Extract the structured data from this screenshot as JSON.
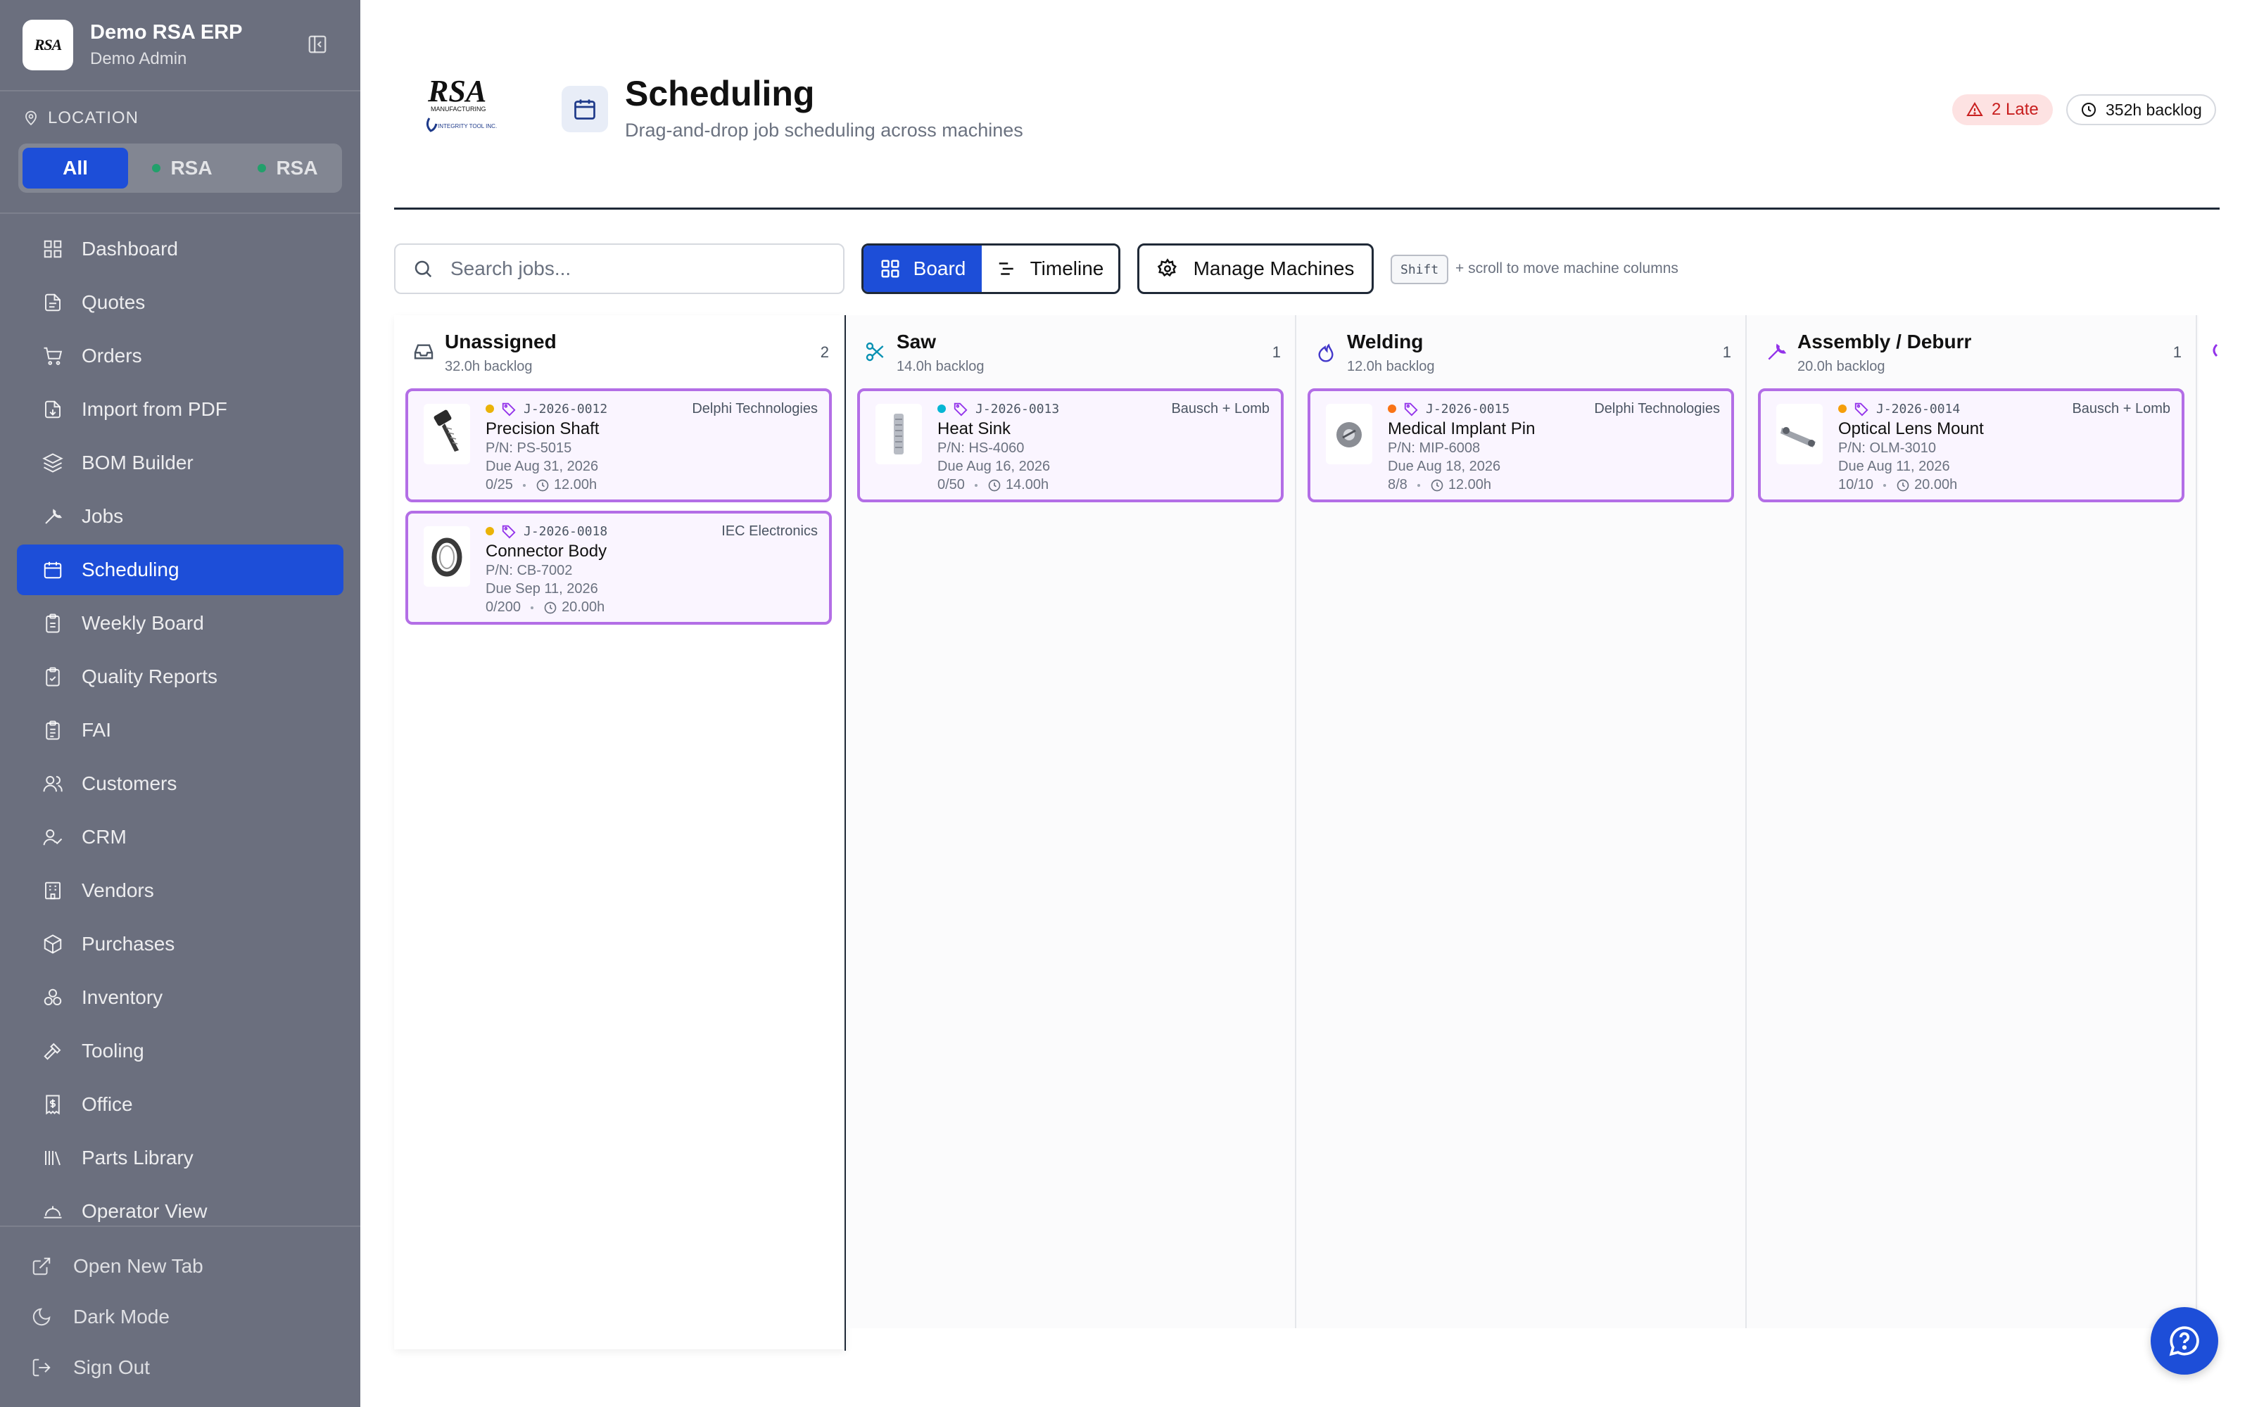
{
  "app": {
    "name": "Demo RSA ERP",
    "user": "Demo Admin",
    "logo_text": "RSA"
  },
  "location": {
    "label": "LOCATION",
    "options": [
      {
        "label": "All",
        "active": true
      },
      {
        "label": "RSA",
        "dot_color": "#22a06b"
      },
      {
        "label": "RSA",
        "dot_color": "#22a06b"
      }
    ]
  },
  "nav": [
    {
      "label": "Dashboard",
      "icon": "dashboard-icon"
    },
    {
      "label": "Quotes",
      "icon": "document-icon"
    },
    {
      "label": "Orders",
      "icon": "cart-icon"
    },
    {
      "label": "Import from PDF",
      "icon": "file-import-icon"
    },
    {
      "label": "BOM Builder",
      "icon": "layers-icon"
    },
    {
      "label": "Jobs",
      "icon": "wrench-icon"
    },
    {
      "label": "Scheduling",
      "icon": "calendar-icon",
      "active": true
    },
    {
      "label": "Weekly Board",
      "icon": "clipboard-icon"
    },
    {
      "label": "Quality Reports",
      "icon": "clipboard-check-icon"
    },
    {
      "label": "FAI",
      "icon": "clipboard-list-icon"
    },
    {
      "label": "Customers",
      "icon": "users-icon"
    },
    {
      "label": "CRM",
      "icon": "user-check-icon"
    },
    {
      "label": "Vendors",
      "icon": "building-icon"
    },
    {
      "label": "Purchases",
      "icon": "package-icon"
    },
    {
      "label": "Inventory",
      "icon": "boxes-icon"
    },
    {
      "label": "Tooling",
      "icon": "hammer-icon"
    },
    {
      "label": "Office",
      "icon": "receipt-icon"
    },
    {
      "label": "Parts Library",
      "icon": "library-icon"
    },
    {
      "label": "Operator View",
      "icon": "operator-icon"
    }
  ],
  "footer": [
    {
      "label": "Open New Tab",
      "icon": "external-link-icon"
    },
    {
      "label": "Dark Mode",
      "icon": "moon-icon"
    },
    {
      "label": "Sign Out",
      "icon": "sign-out-icon"
    }
  ],
  "header": {
    "title": "Scheduling",
    "subtitle": "Drag-and-drop job scheduling across machines",
    "late_badge": "2 Late",
    "backlog_badge": "352h backlog",
    "brand_logo_text": "RSA",
    "brand_logo_sub1": "MANUFACTURING",
    "brand_logo_sub2": "INTEGRITY TOOL INC."
  },
  "toolbar": {
    "search_placeholder": "Search jobs...",
    "view_board": "Board",
    "view_timeline": "Timeline",
    "manage_machines": "Manage Machines",
    "kbd": "Shift",
    "hint": "+ scroll to move machine columns"
  },
  "colors": {
    "accent": "#1d4ed8",
    "card_border": "#b36ee6",
    "card_bg": "#faf5ff",
    "dot_yellow": "#eab308",
    "dot_cyan": "#06b6d4",
    "dot_red": "#f97316",
    "dot_orange": "#f59e0b"
  },
  "columns": [
    {
      "title": "Unassigned",
      "backlog": "32.0h backlog",
      "count": "2",
      "icon": "inbox-icon",
      "jobs": [
        {
          "id": "J-2026-0012",
          "customer": "Delphi Technologies",
          "part": "Precision Shaft",
          "pn": "P/N: PS-5015",
          "due": "Due Aug 31, 2026",
          "qty": "0/25",
          "hours": "12.00h",
          "dot": "#eab308",
          "thumb": "screw-part-icon"
        },
        {
          "id": "J-2026-0018",
          "customer": "IEC Electronics",
          "part": "Connector Body",
          "pn": "P/N: CB-7002",
          "due": "Due Sep 11, 2026",
          "qty": "0/200",
          "hours": "20.00h",
          "dot": "#eab308",
          "thumb": "ring-part-icon"
        }
      ]
    },
    {
      "title": "Saw",
      "backlog": "14.0h backlog",
      "count": "1",
      "icon": "scissors-icon",
      "jobs": [
        {
          "id": "J-2026-0013",
          "customer": "Bausch + Lomb",
          "part": "Heat Sink",
          "pn": "P/N: HS-4060",
          "due": "Due Aug 16, 2026",
          "qty": "0/50",
          "hours": "14.00h",
          "dot": "#06b6d4",
          "thumb": "heatsink-part-icon"
        }
      ]
    },
    {
      "title": "Welding",
      "backlog": "12.0h backlog",
      "count": "1",
      "icon": "flame-icon",
      "jobs": [
        {
          "id": "J-2026-0015",
          "customer": "Delphi Technologies",
          "part": "Medical Implant Pin",
          "pn": "P/N: MIP-6008",
          "due": "Due Aug 18, 2026",
          "qty": "8/8",
          "hours": "12.00h",
          "dot": "#f97316",
          "thumb": "pin-part-icon"
        }
      ]
    },
    {
      "title": "Assembly / Deburr",
      "backlog": "20.0h backlog",
      "count": "1",
      "icon": "wrench-icon",
      "jobs": [
        {
          "id": "J-2026-0014",
          "customer": "Bausch + Lomb",
          "part": "Optical Lens Mount",
          "pn": "P/N: OLM-3010",
          "due": "Due Aug 11, 2026",
          "qty": "10/10",
          "hours": "20.00h",
          "dot": "#f59e0b",
          "thumb": "mount-part-icon"
        }
      ]
    }
  ]
}
